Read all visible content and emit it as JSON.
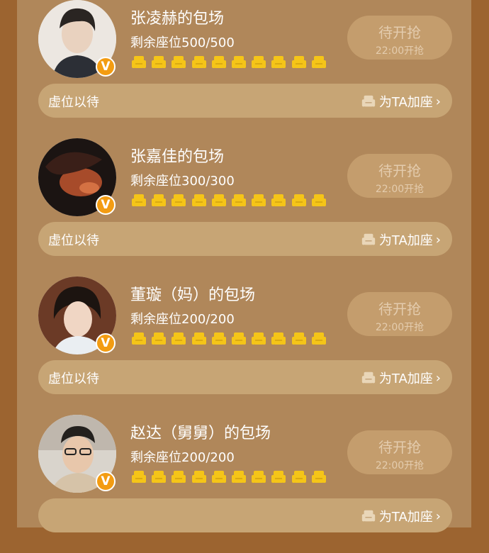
{
  "colors": {
    "background": "#9c6430",
    "panel": "#b0875a",
    "button": "#c49d6d",
    "bar": "#c7a575",
    "seat": "#f5c518",
    "badge": "#f39c12"
  },
  "rooms": [
    {
      "title": "张凌赫的包场",
      "seats_text": "剩余座位500/500",
      "remaining": 500,
      "total": 500,
      "button_main": "待开抢",
      "button_sub": "22:00开抢",
      "bar_text": "虚位以待",
      "bar_action": "为TA加座"
    },
    {
      "title": "张嘉佳的包场",
      "seats_text": "剩余座位300/300",
      "remaining": 300,
      "total": 300,
      "button_main": "待开抢",
      "button_sub": "22:00开抢",
      "bar_text": "虚位以待",
      "bar_action": "为TA加座"
    },
    {
      "title": "董璇（妈）的包场",
      "seats_text": "剩余座位200/200",
      "remaining": 200,
      "total": 200,
      "button_main": "待开抢",
      "button_sub": "22:00开抢",
      "bar_text": "虚位以待",
      "bar_action": "为TA加座"
    },
    {
      "title": "赵达（舅舅）的包场",
      "seats_text": "剩余座位200/200",
      "remaining": 200,
      "total": 200,
      "button_main": "待开抢",
      "button_sub": "22:00开抢",
      "bar_text": "",
      "bar_action": "为TA加座"
    }
  ],
  "badge_letter": "V",
  "icons": {
    "seat": "sofa-icon",
    "verified": "verified-badge-icon",
    "chevron": "chevron-right-icon"
  }
}
